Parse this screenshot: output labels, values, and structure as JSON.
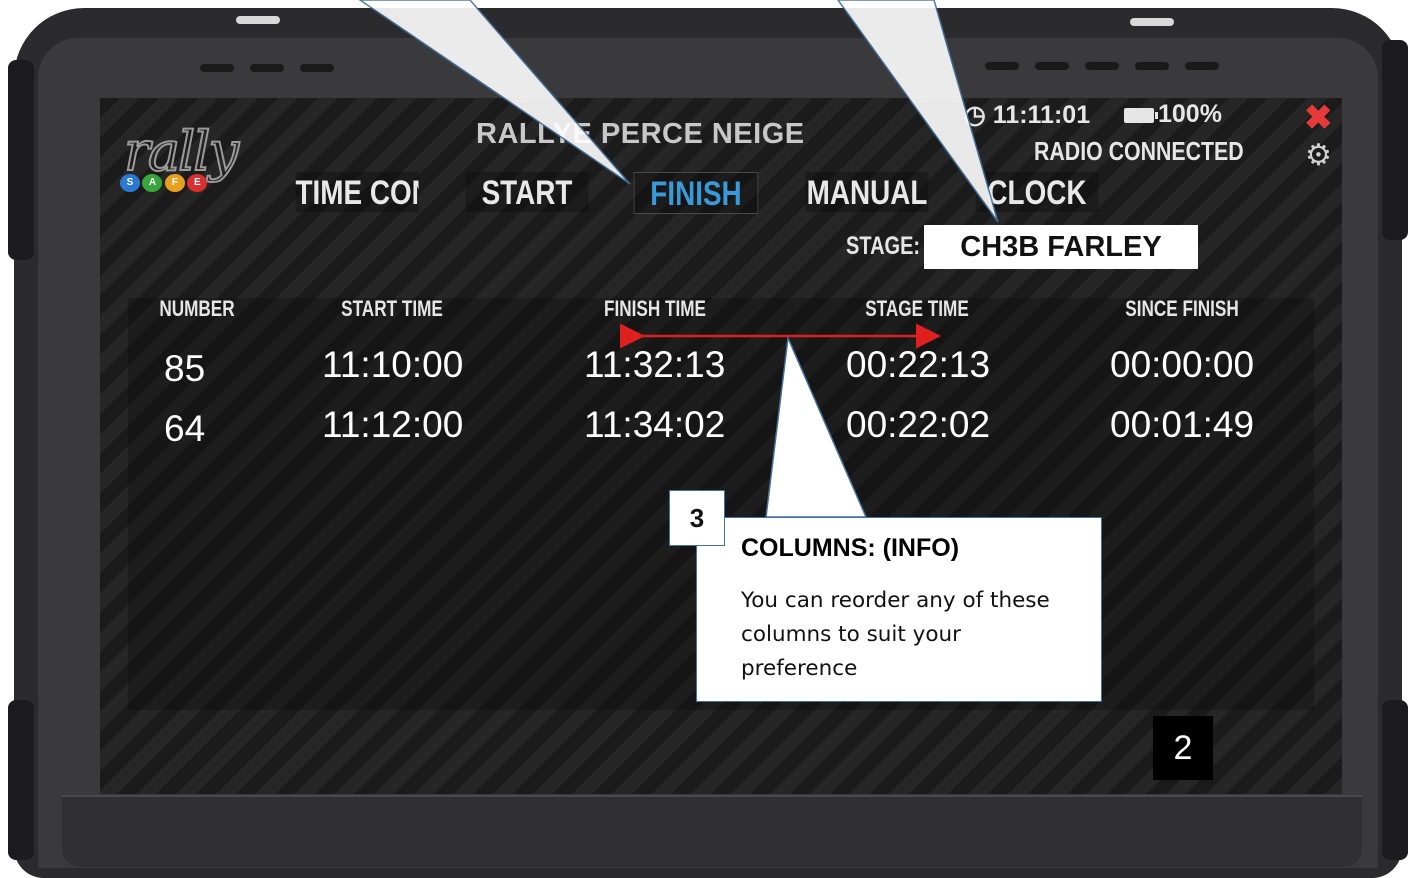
{
  "app": {
    "event_title": "RALLYE PERCE NEIGE",
    "status_time": "11:11:01",
    "battery": "100%",
    "radio_status": "RADIO CONNECTED"
  },
  "logo": {
    "text": "rally",
    "balls": [
      "S",
      "A",
      "F",
      "E"
    ]
  },
  "icons": {
    "close": "close-icon",
    "settings": "gear-icon",
    "clock": "clock-icon",
    "battery": "battery-icon"
  },
  "tabs": [
    {
      "label": "TIME CONTRO",
      "active": false
    },
    {
      "label": "START",
      "active": false
    },
    {
      "label": "FINISH",
      "active": true
    },
    {
      "label": "MANUAL",
      "active": false
    },
    {
      "label": "CLOCK",
      "active": false
    }
  ],
  "stage": {
    "label": "STAGE:",
    "value": "CH3B FARLEY"
  },
  "table": {
    "columns": [
      "NUMBER",
      "START TIME",
      "FINISH TIME",
      "STAGE TIME",
      "SINCE FINISH"
    ],
    "rows": [
      [
        "85",
        "11:10:00",
        "11:32:13",
        "00:22:13",
        "00:00:00"
      ],
      [
        "64",
        "11:12:00",
        "11:34:02",
        "00:22:02",
        "00:01:49"
      ]
    ]
  },
  "page_number": "2",
  "callout": {
    "number": "3",
    "title": "COLUMNS: (INFO)",
    "body": "You can reorder any of these columns to suit your preference"
  },
  "colors": {
    "active_tab": "#3a9ad9",
    "close": "#e53a3a",
    "callout_border": "#41719c",
    "arrow": "#e02020"
  }
}
